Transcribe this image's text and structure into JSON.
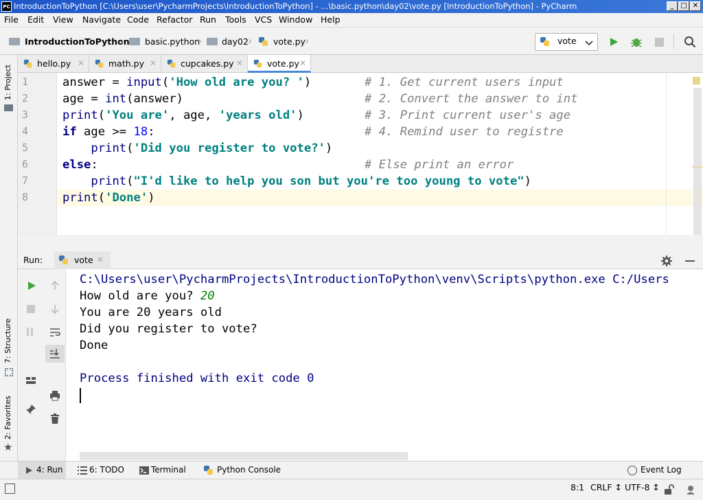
{
  "window": {
    "app_badge": "PC",
    "title": "IntroductionToPython [C:\\Users\\user\\PycharmProjects\\IntroductionToPython] - ...\\basic.python\\day02\\vote.py [IntroductionToPython] - PyCharm",
    "minimize": "_",
    "maximize": "□",
    "close": "✕"
  },
  "menu": [
    "File",
    "Edit",
    "View",
    "Navigate",
    "Code",
    "Refactor",
    "Run",
    "Tools",
    "VCS",
    "Window",
    "Help"
  ],
  "breadcrumb": [
    "IntroductionToPython",
    "basic.python",
    "day02",
    "vote.py"
  ],
  "run_config": {
    "name": "vote"
  },
  "tabs": [
    {
      "label": "hello.py",
      "active": false
    },
    {
      "label": "math.py",
      "active": false
    },
    {
      "label": "cupcakes.py",
      "active": false
    },
    {
      "label": "vote.py",
      "active": true
    }
  ],
  "side_tools": {
    "project": "1: Project",
    "structure": "7: Structure",
    "favorites": "2: Favorites"
  },
  "editor": {
    "line_numbers": [
      "1",
      "2",
      "3",
      "4",
      "5",
      "6",
      "7",
      "8"
    ],
    "lines": [
      "answer = input('How old are you? ')",
      "age = int(answer)",
      "print('You are', age, 'years old')",
      "if age >= 18:",
      "    print('Did you register to vote?')",
      "else:",
      "    print(\"I'd like to help you son but you're too young to vote\")",
      "print('Done')"
    ],
    "comments": [
      "# 1. Get current users input",
      "# 2. Convert the answer to int",
      "# 3. Print current user's age",
      "# 4. Remind user to registre",
      "",
      "# Else print an error",
      "",
      ""
    ],
    "current_line": 8
  },
  "run_panel": {
    "label": "Run:",
    "tab": "vote",
    "output": {
      "command": "C:\\Users\\user\\PycharmProjects\\IntroductionToPython\\venv\\Scripts\\python.exe C:/Users",
      "prompt": "How old are you? ",
      "input": "20",
      "line2": "You are 20 years old",
      "line3": "Did you register to vote?",
      "line4": "Done",
      "finish": "Process finished with exit code 0"
    }
  },
  "bottom_tools": {
    "run": "4: Run",
    "todo": "6: TODO",
    "terminal": "Terminal",
    "console": "Python Console",
    "event_log": "Event Log"
  },
  "status": {
    "position": "8:1",
    "line_sep": "CRLF ↕",
    "encoding": "UTF-8 ↕"
  },
  "colors": {
    "keyword": "#000080",
    "string": "#008080",
    "comment": "#808080",
    "number": "#0000ff",
    "output_cmd": "#000080",
    "input": "#008000"
  }
}
